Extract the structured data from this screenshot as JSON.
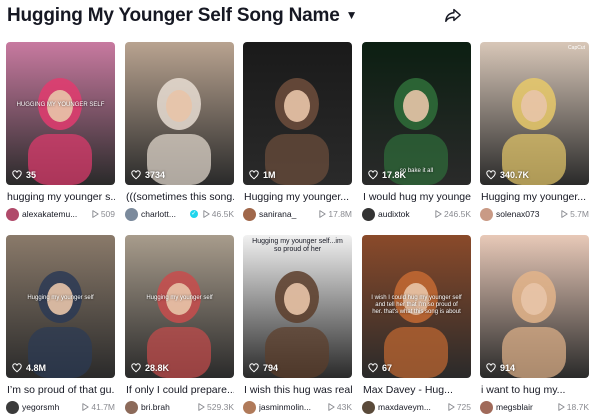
{
  "header": {
    "title": "Hugging My Younger Self Song Name",
    "caret_icon": "caret-down-icon",
    "share_icon": "share-arrow-icon"
  },
  "videos": [
    {
      "views": "35",
      "caption": "hugging my younger s...",
      "user": "alexakatemu...",
      "plays": "509",
      "verified": false,
      "overlay": "HUGGING MY YOUNGER SELF",
      "badge": "",
      "colors": {
        "bg": "#c87aa0",
        "accent": "#e23b6e",
        "avatar": "#b04a6a"
      }
    },
    {
      "views": "3734",
      "caption": "(((sometimes this song...",
      "user": "charlott...",
      "plays": "46.5K",
      "verified": true,
      "overlay": "",
      "badge": "",
      "colors": {
        "bg": "#b9a390",
        "accent": "#e7ddd2",
        "avatar": "#7b8a9c"
      }
    },
    {
      "views": "1M",
      "caption": "Hugging my younger...",
      "user": "sanirana_",
      "plays": "17.8M",
      "verified": false,
      "overlay": "",
      "badge": "",
      "colors": {
        "bg": "#1a1a1a",
        "accent": "#6e4e3c",
        "avatar": "#a0674a"
      }
    },
    {
      "views": "17.8K",
      "caption": "I would hug my younge...",
      "user": "audixtok",
      "plays": "246.5K",
      "verified": false,
      "overlay": "so bake it all",
      "badge": "",
      "colors": {
        "bg": "#0c1f12",
        "accent": "#2f6e3a",
        "avatar": "#333333"
      }
    },
    {
      "views": "340.7K",
      "caption": "Hugging my younger...",
      "user": "solenax073",
      "plays": "5.7M",
      "verified": false,
      "overlay": "",
      "badge": "CapCut",
      "colors": {
        "bg": "#d8c7b8",
        "accent": "#e7c96a",
        "avatar": "#c99a85"
      }
    },
    {
      "views": "4.8M",
      "caption": "I’m so proud of that gu...",
      "user": "yegorsmh",
      "plays": "41.7M",
      "verified": false,
      "overlay": "Hugging my younger self",
      "badge": "",
      "colors": {
        "bg": "#8a7a6a",
        "accent": "#2b3a55",
        "avatar": "#3b3b3b"
      }
    },
    {
      "views": "28.8K",
      "caption": "If only I could prepare...",
      "user": "bri.brah",
      "plays": "529.3K",
      "verified": false,
      "overlay": "Hugging my younger self",
      "badge": "",
      "colors": {
        "bg": "#a89c8c",
        "accent": "#c84c4c",
        "avatar": "#8c6a5a"
      }
    },
    {
      "views": "794",
      "caption": "I wish this hug was real...",
      "user": "jasminmolin...",
      "plays": "43K",
      "verified": false,
      "overlay": "Hugging my younger self...im so proud of her",
      "badge": "",
      "colors": {
        "bg": "#f1f1f1",
        "accent": "#5c3d2a",
        "avatar": "#b07a5a"
      }
    },
    {
      "views": "67",
      "caption": "Max Davey - Hug...",
      "user": "maxdaveym...",
      "plays": "725",
      "verified": false,
      "overlay": "I wish I could hug my younger self and tell her that I'm so proud of her. that's what this song is about",
      "badge": "",
      "colors": {
        "bg": "#8a4a2a",
        "accent": "#c46a32",
        "avatar": "#5a4a3a"
      }
    },
    {
      "views": "914",
      "caption": "i want to hug my...",
      "user": "megsblair",
      "plays": "18.7K",
      "verified": false,
      "overlay": "",
      "badge": "",
      "colors": {
        "bg": "#e8c9b8",
        "accent": "#e3b48a",
        "avatar": "#a06a5a"
      }
    }
  ]
}
